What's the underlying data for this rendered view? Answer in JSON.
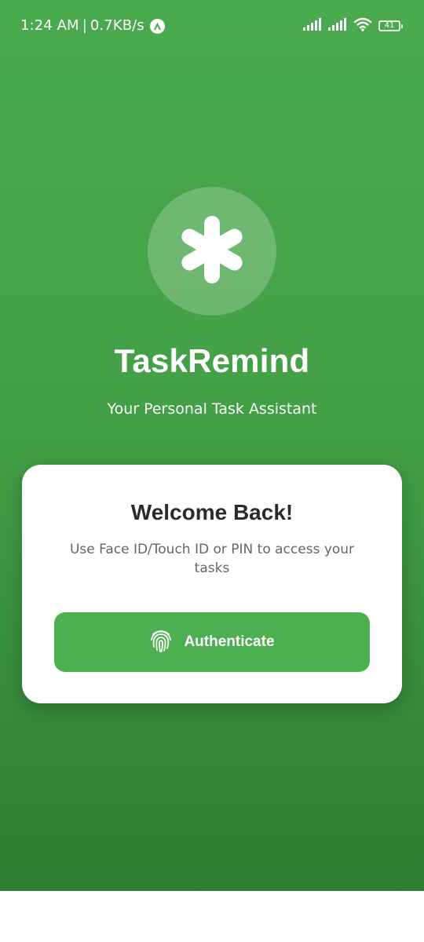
{
  "status_bar": {
    "time": "1:24 AM",
    "separator": "|",
    "network_speed": "0.7KB/s",
    "battery_level": "41"
  },
  "app": {
    "name": "TaskRemind",
    "tagline": "Your Personal Task Assistant",
    "logo_icon": "asterisk-icon"
  },
  "card": {
    "title": "Welcome Back!",
    "message": "Use Face ID/Touch ID or PIN to access your tasks",
    "button": {
      "label": "Authenticate",
      "icon": "fingerprint-icon"
    }
  },
  "colors": {
    "primary_green": "#4caf50",
    "gradient_top": "#4aaa4e",
    "gradient_bottom": "#2f7d32",
    "card_background": "#ffffff",
    "title_text": "#2b2b2b",
    "body_text": "#666666"
  }
}
